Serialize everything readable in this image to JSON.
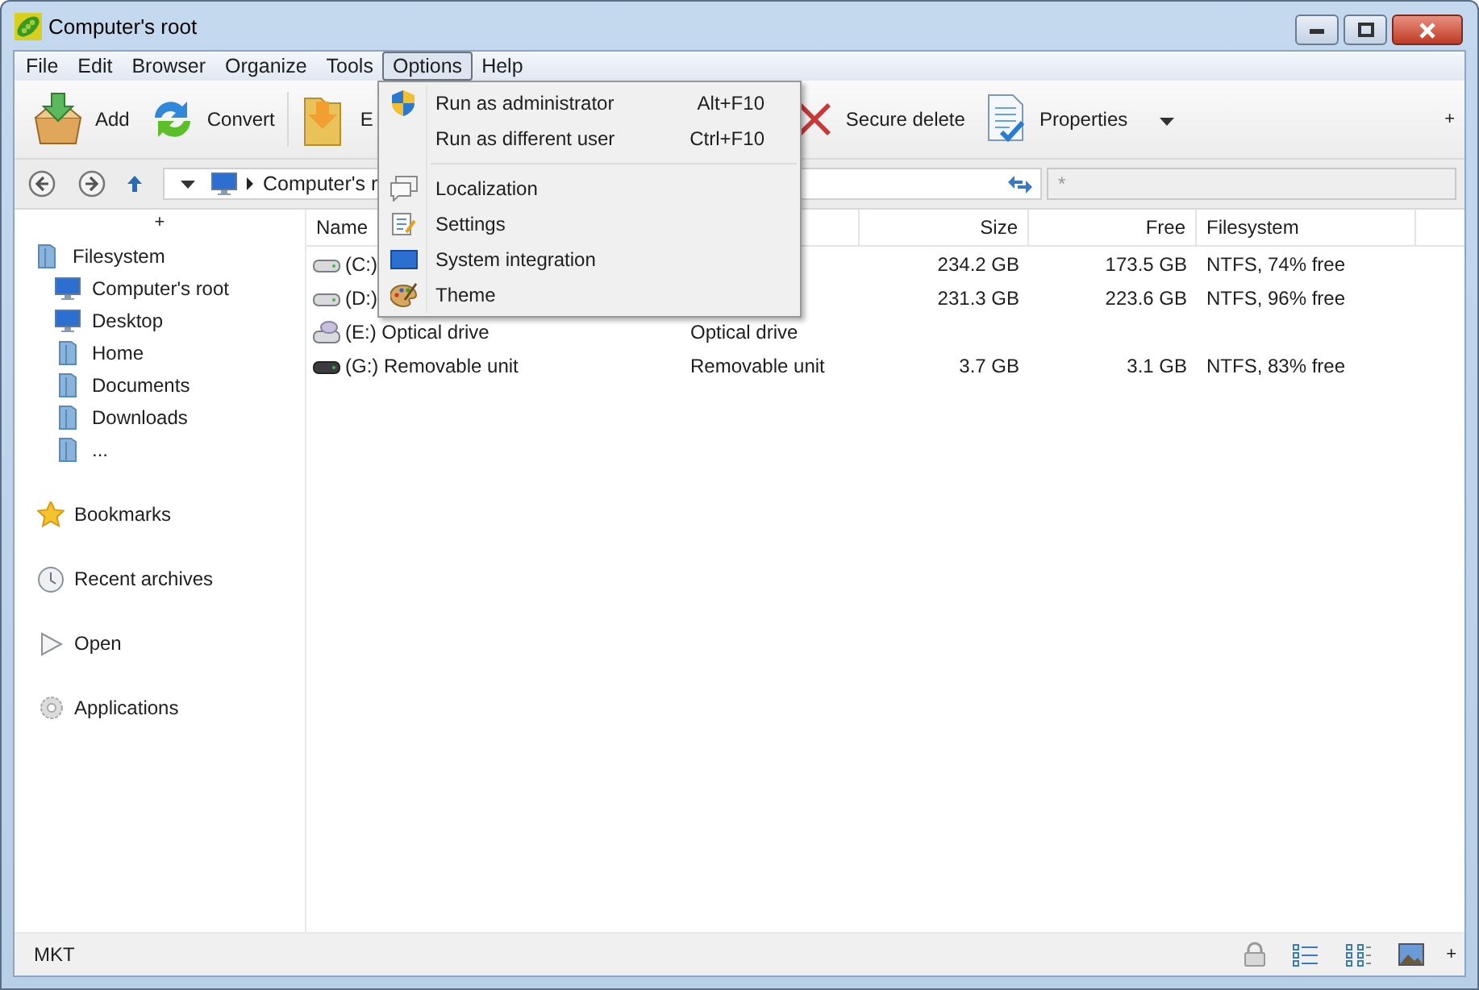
{
  "window": {
    "title": "Computer's root"
  },
  "menu": [
    {
      "label": "File",
      "selected": false
    },
    {
      "label": "Edit",
      "selected": false
    },
    {
      "label": "Browser",
      "selected": false
    },
    {
      "label": "Organize",
      "selected": false
    },
    {
      "label": "Tools",
      "selected": false
    },
    {
      "label": "Options",
      "selected": true
    },
    {
      "label": "Help",
      "selected": false
    }
  ],
  "options_menu": [
    {
      "kind": "item",
      "label": "Run as administrator",
      "shortcut": "Alt+F10"
    },
    {
      "kind": "item",
      "label": "Run as different user",
      "shortcut": "Ctrl+F10"
    },
    {
      "kind": "separator"
    },
    {
      "kind": "item",
      "label": "Localization"
    },
    {
      "kind": "item",
      "label": "Settings"
    },
    {
      "kind": "item",
      "label": "System integration"
    },
    {
      "kind": "item",
      "label": "Theme"
    }
  ],
  "toolbar": {
    "buttons": [
      {
        "label": "Add"
      },
      {
        "label": "Convert"
      },
      {
        "label": "E"
      },
      {
        "label": "Secure delete"
      },
      {
        "label": "Properties",
        "dropdown": true
      }
    ],
    "more": "+"
  },
  "address": {
    "path": "Computer's r",
    "search_placeholder": "*"
  },
  "sidebar": {
    "more": "+",
    "tree": [
      {
        "label": "Filesystem",
        "children": [
          {
            "label": "Computer's root"
          },
          {
            "label": "Desktop"
          },
          {
            "label": "Home"
          },
          {
            "label": "Documents"
          },
          {
            "label": "Downloads"
          },
          {
            "label": "..."
          }
        ]
      }
    ],
    "sections": [
      {
        "label": "Bookmarks"
      },
      {
        "label": "Recent archives"
      },
      {
        "label": "Open"
      },
      {
        "label": "Applications"
      }
    ]
  },
  "table": {
    "columns": [
      {
        "label": "Name"
      },
      {},
      {
        "label": "Size"
      },
      {
        "label": "Free"
      },
      {
        "label": "Filesystem"
      }
    ],
    "rows": [
      {
        "kind": "disk",
        "name": "(C:)",
        "size": "234.2 GB",
        "free": "173.5 GB",
        "filesystem": "NTFS, 74% free"
      },
      {
        "kind": "disk",
        "name": "(D:)",
        "size": "231.3 GB",
        "free": "223.6 GB",
        "filesystem": "NTFS, 96% free"
      },
      {
        "kind": "optical",
        "name": "(E:) Optical drive",
        "type": "Optical drive"
      },
      {
        "kind": "removable",
        "name": "(G:) Removable unit",
        "type": "Removable unit",
        "size": "3.7 GB",
        "free": "3.1 GB",
        "filesystem": "NTFS, 83% free"
      }
    ]
  },
  "status_bar": {
    "text": "MKT",
    "more": "+"
  }
}
